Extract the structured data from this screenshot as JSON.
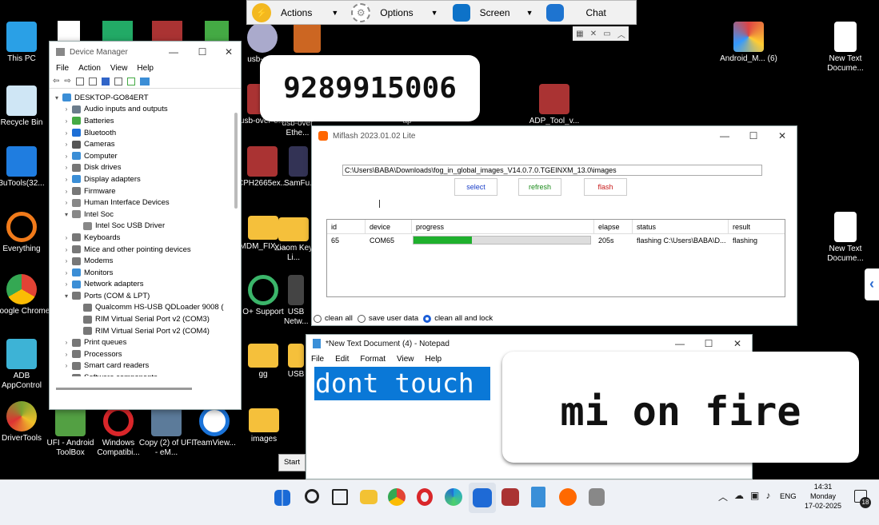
{
  "desktop": {
    "icons": [
      {
        "label": "This PC",
        "color": "#2aa0e6"
      },
      {
        "label": "Recycle Bin",
        "color": "#cfe6f5"
      },
      {
        "label": "3uTools(32...",
        "color": "#1f7de0"
      },
      {
        "label": "Everything",
        "color": "#f07a1a"
      },
      {
        "label": "Google Chrome",
        "color": "#e24335"
      },
      {
        "label": "ADB AppControl",
        "color": "#3db3d6"
      },
      {
        "label": "DriverTools",
        "color": "#7aa230"
      },
      {
        "label": "UFI - Android ToolBox",
        "color": "#53a043"
      },
      {
        "label": "Windows Compatibi...",
        "color": "#d9262a"
      },
      {
        "label": "Copy (2) of UFI - eM...",
        "color": "#5c7b9a"
      },
      {
        "label": "TeamView...",
        "color": "#1a73d9"
      },
      {
        "label": "images",
        "color": "#f5c03b"
      },
      {
        "label": "usb-ov...",
        "color": "#aac"
      },
      {
        "label": "usb-over-e...",
        "color": "#a33"
      },
      {
        "label": "usb-over Ethe...",
        "color": "#eee"
      },
      {
        "label": "ap",
        "color": "#333"
      },
      {
        "label": "CPH2665ex...",
        "color": "#a33"
      },
      {
        "label": "SamFu...",
        "color": "#335"
      },
      {
        "label": "MDM_FIX_...",
        "color": "#f5c03b"
      },
      {
        "label": "Xiaom Key Li...",
        "color": "#f5c03b"
      },
      {
        "label": "O+ Support",
        "color": "#3bb56a"
      },
      {
        "label": "USB Netw...",
        "color": "#444"
      },
      {
        "label": "gg",
        "color": "#f5c03b"
      },
      {
        "label": "USB",
        "color": "#f5c03b"
      },
      {
        "label": "Android_M... (6)",
        "color": "#d44"
      },
      {
        "label": "New Text Docume...",
        "color": "#fff"
      },
      {
        "label": "ADP_Tool_v...",
        "color": "#a33"
      },
      {
        "label": "New Text Docume...",
        "color": "#fff"
      }
    ]
  },
  "remote_toolbar": {
    "actions": "Actions",
    "options": "Options",
    "screen": "Screen",
    "chat": "Chat"
  },
  "overlays": {
    "phone": "9289915006",
    "message": "mi on fire"
  },
  "device_manager": {
    "title": "Device Manager",
    "menu": [
      "File",
      "Action",
      "View",
      "Help"
    ],
    "root": "DESKTOP-GO84ERT",
    "items": [
      {
        "label": "Audio inputs and outputs",
        "color": "#6b7c8c"
      },
      {
        "label": "Batteries",
        "color": "#4a4"
      },
      {
        "label": "Bluetooth",
        "color": "#1d6fd6"
      },
      {
        "label": "Cameras",
        "color": "#555"
      },
      {
        "label": "Computer",
        "color": "#3b8ed6"
      },
      {
        "label": "Disk drives",
        "color": "#777"
      },
      {
        "label": "Display adapters",
        "color": "#3b8ed6"
      },
      {
        "label": "Firmware",
        "color": "#777"
      },
      {
        "label": "Human Interface Devices",
        "color": "#888"
      },
      {
        "label": "Intel Soc",
        "color": "#888"
      },
      {
        "label": "Intel Soc USB Driver",
        "color": "#888",
        "child": true
      },
      {
        "label": "Keyboards",
        "color": "#777"
      },
      {
        "label": "Mice and other pointing devices",
        "color": "#777"
      },
      {
        "label": "Modems",
        "color": "#777"
      },
      {
        "label": "Monitors",
        "color": "#3b8ed6"
      },
      {
        "label": "Network adapters",
        "color": "#3b8ed6"
      },
      {
        "label": "Ports (COM & LPT)",
        "color": "#777"
      },
      {
        "label": "Qualcomm HS-USB QDLoader 9008 (",
        "color": "#777",
        "child": true
      },
      {
        "label": "RIM Virtual Serial Port v2 (COM3)",
        "color": "#777",
        "child": true
      },
      {
        "label": "RIM Virtual Serial Port v2 (COM4)",
        "color": "#777",
        "child": true
      },
      {
        "label": "Print queues",
        "color": "#777"
      },
      {
        "label": "Processors",
        "color": "#777"
      },
      {
        "label": "Smart card readers",
        "color": "#777"
      },
      {
        "label": "Software components",
        "color": "#777"
      }
    ]
  },
  "miflash": {
    "title": "Miflash 2023.01.02 Lite",
    "path": "C:\\Users\\BABA\\Downloads\\fog_in_global_images_V14.0.7.0.TGEINXM_13.0\\images",
    "buttons": {
      "select": "select",
      "refresh": "refresh",
      "flash": "flash"
    },
    "columns": [
      "id",
      "device",
      "progress",
      "elapse",
      "status",
      "result"
    ],
    "row": {
      "id": "65",
      "device": "COM65",
      "progress": 0.33,
      "elapse": "205s",
      "status": "flashing C:\\Users\\BABA\\D...",
      "result": "flashing"
    },
    "options": [
      "clean all",
      "save user data",
      "clean all and lock"
    ],
    "selected_option": 2
  },
  "notepad": {
    "title": "*New Text Document (4) - Notepad",
    "menu": [
      "File",
      "Edit",
      "Format",
      "View",
      "Help"
    ],
    "content": "dont touch"
  },
  "start_tooltip": "Start",
  "tray": {
    "lang": "ENG",
    "time": "14:31",
    "day": "Monday",
    "date": "17-02-2025",
    "notif": "18"
  }
}
